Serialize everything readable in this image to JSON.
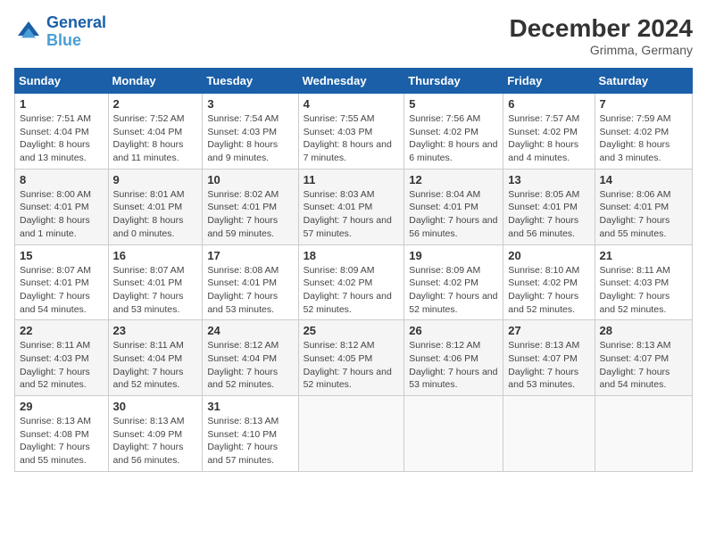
{
  "header": {
    "logo_general": "General",
    "logo_blue": "Blue",
    "month_title": "December 2024",
    "location": "Grimma, Germany"
  },
  "weekdays": [
    "Sunday",
    "Monday",
    "Tuesday",
    "Wednesday",
    "Thursday",
    "Friday",
    "Saturday"
  ],
  "weeks": [
    [
      {
        "day": "1",
        "sunrise": "7:51 AM",
        "sunset": "4:04 PM",
        "daylight": "8 hours and 13 minutes."
      },
      {
        "day": "2",
        "sunrise": "7:52 AM",
        "sunset": "4:04 PM",
        "daylight": "8 hours and 11 minutes."
      },
      {
        "day": "3",
        "sunrise": "7:54 AM",
        "sunset": "4:03 PM",
        "daylight": "8 hours and 9 minutes."
      },
      {
        "day": "4",
        "sunrise": "7:55 AM",
        "sunset": "4:03 PM",
        "daylight": "8 hours and 7 minutes."
      },
      {
        "day": "5",
        "sunrise": "7:56 AM",
        "sunset": "4:02 PM",
        "daylight": "8 hours and 6 minutes."
      },
      {
        "day": "6",
        "sunrise": "7:57 AM",
        "sunset": "4:02 PM",
        "daylight": "8 hours and 4 minutes."
      },
      {
        "day": "7",
        "sunrise": "7:59 AM",
        "sunset": "4:02 PM",
        "daylight": "8 hours and 3 minutes."
      }
    ],
    [
      {
        "day": "8",
        "sunrise": "8:00 AM",
        "sunset": "4:01 PM",
        "daylight": "8 hours and 1 minute."
      },
      {
        "day": "9",
        "sunrise": "8:01 AM",
        "sunset": "4:01 PM",
        "daylight": "8 hours and 0 minutes."
      },
      {
        "day": "10",
        "sunrise": "8:02 AM",
        "sunset": "4:01 PM",
        "daylight": "7 hours and 59 minutes."
      },
      {
        "day": "11",
        "sunrise": "8:03 AM",
        "sunset": "4:01 PM",
        "daylight": "7 hours and 57 minutes."
      },
      {
        "day": "12",
        "sunrise": "8:04 AM",
        "sunset": "4:01 PM",
        "daylight": "7 hours and 56 minutes."
      },
      {
        "day": "13",
        "sunrise": "8:05 AM",
        "sunset": "4:01 PM",
        "daylight": "7 hours and 56 minutes."
      },
      {
        "day": "14",
        "sunrise": "8:06 AM",
        "sunset": "4:01 PM",
        "daylight": "7 hours and 55 minutes."
      }
    ],
    [
      {
        "day": "15",
        "sunrise": "8:07 AM",
        "sunset": "4:01 PM",
        "daylight": "7 hours and 54 minutes."
      },
      {
        "day": "16",
        "sunrise": "8:07 AM",
        "sunset": "4:01 PM",
        "daylight": "7 hours and 53 minutes."
      },
      {
        "day": "17",
        "sunrise": "8:08 AM",
        "sunset": "4:01 PM",
        "daylight": "7 hours and 53 minutes."
      },
      {
        "day": "18",
        "sunrise": "8:09 AM",
        "sunset": "4:02 PM",
        "daylight": "7 hours and 52 minutes."
      },
      {
        "day": "19",
        "sunrise": "8:09 AM",
        "sunset": "4:02 PM",
        "daylight": "7 hours and 52 minutes."
      },
      {
        "day": "20",
        "sunrise": "8:10 AM",
        "sunset": "4:02 PM",
        "daylight": "7 hours and 52 minutes."
      },
      {
        "day": "21",
        "sunrise": "8:11 AM",
        "sunset": "4:03 PM",
        "daylight": "7 hours and 52 minutes."
      }
    ],
    [
      {
        "day": "22",
        "sunrise": "8:11 AM",
        "sunset": "4:03 PM",
        "daylight": "7 hours and 52 minutes."
      },
      {
        "day": "23",
        "sunrise": "8:11 AM",
        "sunset": "4:04 PM",
        "daylight": "7 hours and 52 minutes."
      },
      {
        "day": "24",
        "sunrise": "8:12 AM",
        "sunset": "4:04 PM",
        "daylight": "7 hours and 52 minutes."
      },
      {
        "day": "25",
        "sunrise": "8:12 AM",
        "sunset": "4:05 PM",
        "daylight": "7 hours and 52 minutes."
      },
      {
        "day": "26",
        "sunrise": "8:12 AM",
        "sunset": "4:06 PM",
        "daylight": "7 hours and 53 minutes."
      },
      {
        "day": "27",
        "sunrise": "8:13 AM",
        "sunset": "4:07 PM",
        "daylight": "7 hours and 53 minutes."
      },
      {
        "day": "28",
        "sunrise": "8:13 AM",
        "sunset": "4:07 PM",
        "daylight": "7 hours and 54 minutes."
      }
    ],
    [
      {
        "day": "29",
        "sunrise": "8:13 AM",
        "sunset": "4:08 PM",
        "daylight": "7 hours and 55 minutes."
      },
      {
        "day": "30",
        "sunrise": "8:13 AM",
        "sunset": "4:09 PM",
        "daylight": "7 hours and 56 minutes."
      },
      {
        "day": "31",
        "sunrise": "8:13 AM",
        "sunset": "4:10 PM",
        "daylight": "7 hours and 57 minutes."
      },
      null,
      null,
      null,
      null
    ]
  ]
}
